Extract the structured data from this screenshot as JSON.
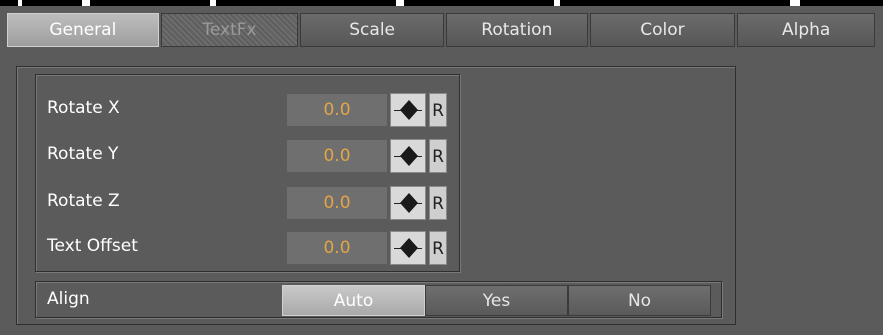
{
  "tabs": [
    {
      "label": "General",
      "state": "active"
    },
    {
      "label": "TextFx",
      "state": "disabled"
    },
    {
      "label": "Scale",
      "state": "normal"
    },
    {
      "label": "Rotation",
      "state": "normal"
    },
    {
      "label": "Color",
      "state": "normal"
    },
    {
      "label": "Alpha",
      "state": "normal"
    }
  ],
  "rows": [
    {
      "label": "Rotate X",
      "value": "0.0",
      "reset": "R"
    },
    {
      "label": "Rotate Y",
      "value": "0.0",
      "reset": "R"
    },
    {
      "label": "Rotate Z",
      "value": "0.0",
      "reset": "R"
    },
    {
      "label": "Text Offset",
      "value": "0.0",
      "reset": "R"
    }
  ],
  "align": {
    "label": "Align",
    "options": [
      "Auto",
      "Yes",
      "No"
    ],
    "selected": "Auto"
  },
  "icons": {
    "spinner": "up-down-spinner-icon"
  },
  "colors": {
    "value_text": "#e2a547",
    "background": "#5b5b5b"
  }
}
